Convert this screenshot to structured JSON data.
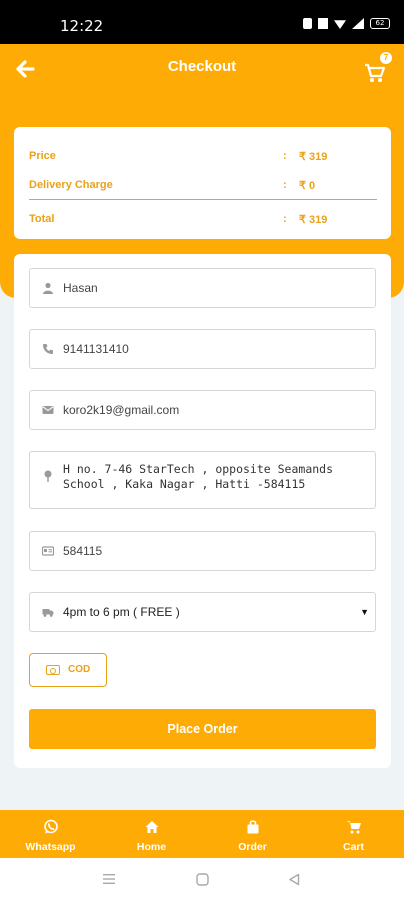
{
  "status_bar": {
    "time": "12:22",
    "battery": "62"
  },
  "header": {
    "title": "Checkout",
    "cart_count": "7"
  },
  "summary": {
    "rows": [
      {
        "label": "Price",
        "colon": ":",
        "value": "₹ 319"
      },
      {
        "label": "Delivery Charge",
        "colon": ":",
        "value": "₹ 0"
      },
      {
        "label": "Total",
        "colon": ":",
        "value": "₹ 319"
      }
    ]
  },
  "form": {
    "name": "Hasan",
    "phone": "9141131410",
    "email": "koro2k19@gmail.com",
    "address": "H no. 7-46 StarTech , opposite Seamands School , Kaka Nagar , Hatti -584115",
    "pincode": "584115",
    "delivery_slot": "4pm to 6 pm ( FREE )",
    "payment_method": "COD",
    "submit_label": "Place Order"
  },
  "bottom_nav": [
    {
      "label": "Whatsapp",
      "icon": "whatsapp-icon"
    },
    {
      "label": "Home",
      "icon": "home-icon"
    },
    {
      "label": "Order",
      "icon": "shopping-bag-icon"
    },
    {
      "label": "Cart",
      "icon": "cart-icon"
    }
  ],
  "colors": {
    "accent": "#ffab06",
    "accent_text": "#e9a21a",
    "background": "#eef4f5"
  }
}
